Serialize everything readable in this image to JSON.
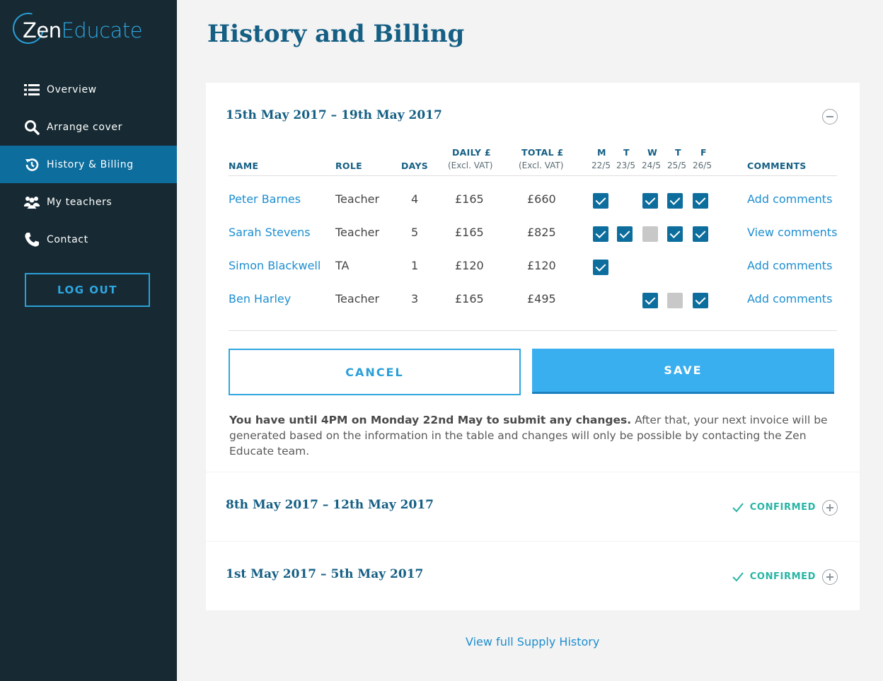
{
  "brand": {
    "logo_prefix": "Zen",
    "logo_suffix": "Educate"
  },
  "nav": [
    {
      "label": "Overview",
      "icon": "list-icon",
      "active": false
    },
    {
      "label": "Arrange cover",
      "icon": "search-icon",
      "active": false
    },
    {
      "label": "History & Billing",
      "icon": "history-icon",
      "active": true
    },
    {
      "label": "My teachers",
      "icon": "users-icon",
      "active": false
    },
    {
      "label": "Contact",
      "icon": "phone-icon",
      "active": false
    }
  ],
  "logout_label": "LOG OUT",
  "page_title": "History and Billing",
  "open_week": {
    "title": "15th May 2017 – 19th May 2017",
    "headers": {
      "name": "NAME",
      "role": "ROLE",
      "days": "DAYS",
      "daily": "DAILY £",
      "daily_sub": "(Excl. VAT)",
      "total": "TOTAL £",
      "total_sub": "(Excl. VAT)",
      "comments": "COMMENTS",
      "day_letters": [
        "M",
        "T",
        "W",
        "T",
        "F"
      ],
      "day_dates": [
        "22/5",
        "23/5",
        "24/5",
        "25/5",
        "26/5"
      ]
    },
    "rows": [
      {
        "name": "Peter Barnes",
        "role": "Teacher",
        "days": "4",
        "daily": "£165",
        "total": "£660",
        "checks": [
          "on",
          "none",
          "on",
          "on",
          "on"
        ],
        "comment": "Add comments"
      },
      {
        "name": "Sarah Stevens",
        "role": "Teacher",
        "days": "5",
        "daily": "£165",
        "total": "£825",
        "checks": [
          "on",
          "on",
          "off",
          "on",
          "on"
        ],
        "comment": "View comments"
      },
      {
        "name": "Simon Blackwell",
        "role": "TA",
        "days": "1",
        "daily": "£120",
        "total": "£120",
        "checks": [
          "on",
          "none",
          "none",
          "none",
          "none"
        ],
        "comment": "Add comments"
      },
      {
        "name": "Ben Harley",
        "role": "Teacher",
        "days": "3",
        "daily": "£165",
        "total": "£495",
        "checks": [
          "none",
          "none",
          "on",
          "off",
          "on"
        ],
        "comment": "Add comments"
      }
    ],
    "cancel_label": "CANCEL",
    "save_label": "SAVE",
    "notice_bold": "You have until 4PM on Monday 22nd May to submit any changes.",
    "notice_rest": " After that, your next invoice will be generated based on the information in the table and changes will only be possible by contacting the Zen Educate team."
  },
  "past_weeks": [
    {
      "title": "8th May 2017 – 12th May 2017",
      "status": "CONFIRMED"
    },
    {
      "title": "1st May 2017 – 5th May 2017",
      "status": "CONFIRMED"
    }
  ],
  "full_history_link": "View full Supply History",
  "colors": {
    "sidebar": "#172a33",
    "active_nav": "#0d6e9e",
    "accent": "#2ea6e0",
    "title": "#155f84",
    "confirmed": "#27b5a5"
  }
}
